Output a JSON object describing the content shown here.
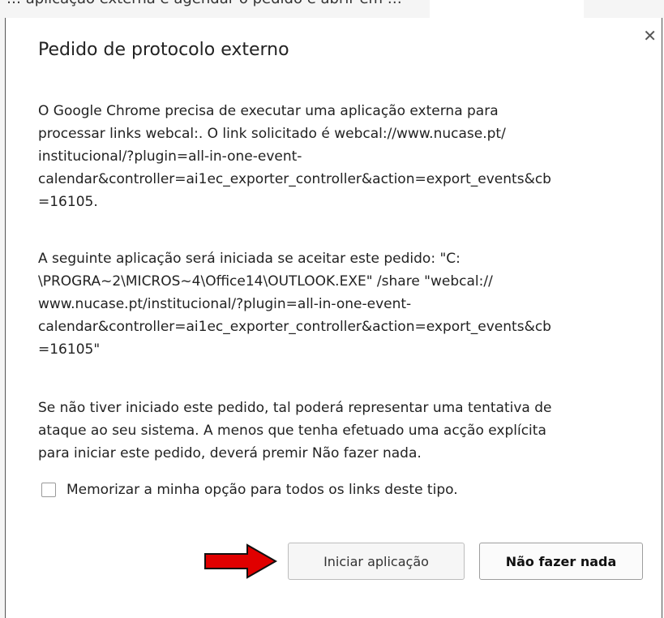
{
  "top_clip": {
    "text": "… aplicação externa e agendar o pedido e abrir em …"
  },
  "dialog": {
    "title": "Pedido de protocolo externo",
    "close_icon": "close-icon",
    "paragraph1": [
      "O Google Chrome precisa de executar uma aplicação externa para",
      "processar links webcal:. O link solicitado é webcal://www.nucase.pt/",
      "institucional/?plugin=all-in-one-event-",
      "calendar&controller=ai1ec_exporter_controller&action=export_events&cb",
      "=16105."
    ],
    "paragraph2": [
      "A seguinte aplicação será iniciada se aceitar este pedido: \"C:",
      "\\PROGRA~2\\MICROS~4\\Office14\\OUTLOOK.EXE\" /share \"webcal://",
      "www.nucase.pt/institucional/?plugin=all-in-one-event-",
      "calendar&controller=ai1ec_exporter_controller&action=export_events&cb",
      "=16105\""
    ],
    "paragraph3": [
      "Se não tiver iniciado este pedido, tal poderá representar uma tentativa de",
      "ataque ao seu sistema. A menos que tenha efetuado uma acção explícita",
      "para iniciar este pedido, deverá premir Não fazer nada."
    ],
    "remember_checkbox": {
      "label": "Memorizar a minha opção para todos os links deste tipo.",
      "checked": false
    },
    "buttons": {
      "launch": "Iniciar aplicação",
      "do_nothing": "Não fazer nada"
    }
  },
  "annotation": {
    "arrow_icon": "red-arrow-icon",
    "arrow_color": "#e00000"
  }
}
